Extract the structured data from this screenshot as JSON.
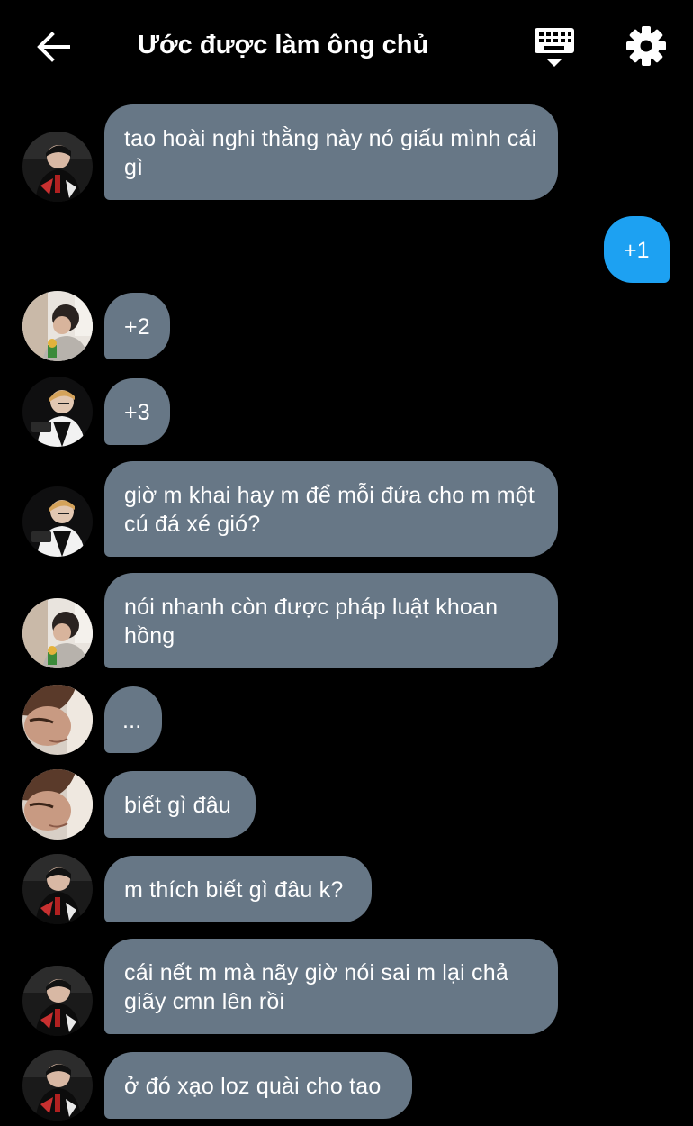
{
  "header": {
    "title": "Ước được làm ông chủ",
    "back_icon": "arrow-left-icon",
    "keyboard_icon": "keyboard-icon",
    "settings_icon": "gear-icon"
  },
  "colors": {
    "background": "#000000",
    "incoming_bubble": "#677786",
    "outgoing_bubble": "#1da1f2",
    "text": "#ffffff"
  },
  "messages": [
    {
      "sender": "avatar-a",
      "direction": "in",
      "text": "tao hoài nghi thằng này nó giấu mình cái gì"
    },
    {
      "sender": "me",
      "direction": "out",
      "text": "+1"
    },
    {
      "sender": "avatar-b",
      "direction": "in",
      "text": "+2"
    },
    {
      "sender": "avatar-c",
      "direction": "in",
      "text": "+3"
    },
    {
      "sender": "avatar-c",
      "direction": "in",
      "text": "giờ m khai hay m để mỗi đứa cho m một cú đá xé gió?"
    },
    {
      "sender": "avatar-b",
      "direction": "in",
      "text": "nói nhanh còn được pháp luật khoan hồng"
    },
    {
      "sender": "avatar-d",
      "direction": "in",
      "text": "..."
    },
    {
      "sender": "avatar-d",
      "direction": "in",
      "text": "biết gì đâu"
    },
    {
      "sender": "avatar-a",
      "direction": "in",
      "text": "m thích biết gì đâu k?"
    },
    {
      "sender": "avatar-a",
      "direction": "in",
      "text": "cái nết m mà nãy giờ nói sai m lại chả giãy cmn lên rồi"
    },
    {
      "sender": "avatar-a",
      "direction": "in",
      "text": "ở đó xạo loz quài cho tao"
    }
  ]
}
